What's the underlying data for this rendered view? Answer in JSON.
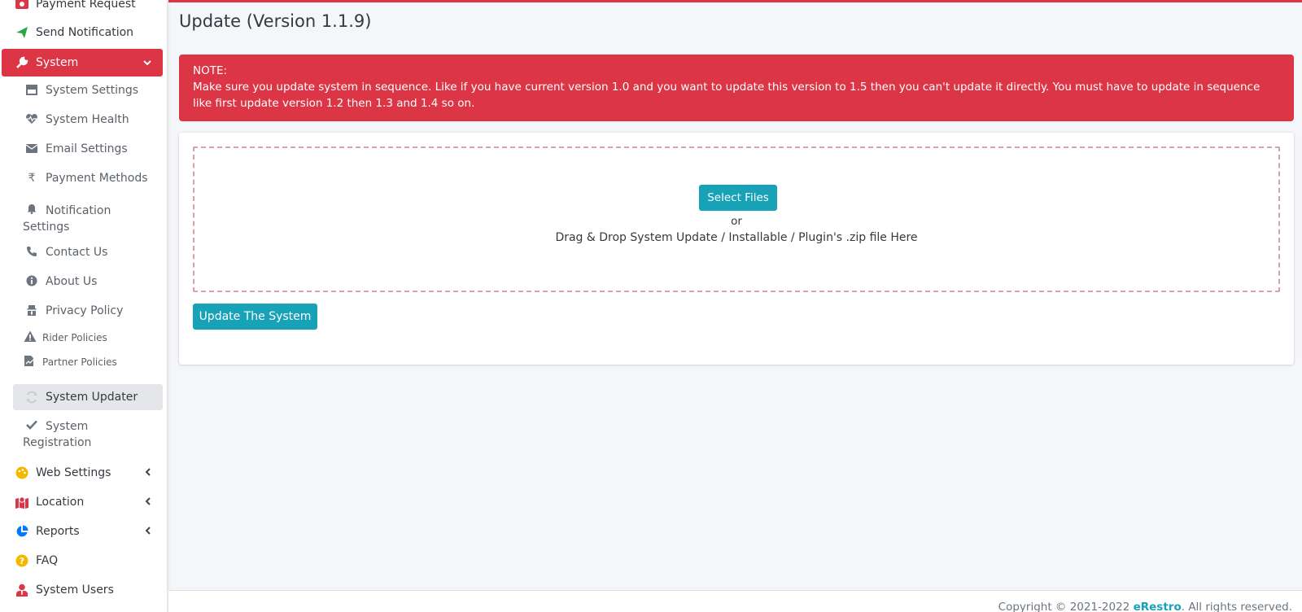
{
  "sidebar": {
    "payment_request": "Payment Request",
    "send_notification": "Send Notification",
    "system": "System",
    "system_settings": "System Settings",
    "system_health": "System Health",
    "email_settings": "Email Settings",
    "payment_methods": "Payment Methods",
    "notification_settings_1": "Notification",
    "notification_settings_2": "Settings",
    "contact_us": "Contact Us",
    "about_us": "About Us",
    "privacy_policy": "Privacy Policy",
    "rider_policies": "Rider Policies",
    "partner_policies": "Partner Policies",
    "system_updater": "System Updater",
    "system_registration_1": "System",
    "system_registration_2": "Registration",
    "web_settings": "Web Settings",
    "location": "Location",
    "reports": "Reports",
    "faq": "FAQ",
    "system_users": "System Users"
  },
  "page": {
    "title": "Update (Version 1.1.9)"
  },
  "alert": {
    "heading": "NOTE:",
    "message": "Make sure you update system in sequence. Like if you have current version 1.0 and you want to update this version to 1.5 then you can't update it directly. You must have to update in sequence like first update version 1.2 then 1.3 and 1.4 so on."
  },
  "dropzone": {
    "select_button": "Select Files",
    "or": "or",
    "instructions": "Drag & Drop System Update / Installable / Plugin's .zip file Here"
  },
  "actions": {
    "update_button": "Update The System"
  },
  "footer": {
    "copyright": "Copyright © 2021-2022 ",
    "brand": "eRestro",
    "rights": ". All rights reserved."
  },
  "colors": {
    "accent_red": "#dc3545",
    "accent_teal": "#17a2b8",
    "green_icon": "#28a745",
    "yellow_icon": "#f5b800",
    "blue_icon": "#007bff"
  }
}
